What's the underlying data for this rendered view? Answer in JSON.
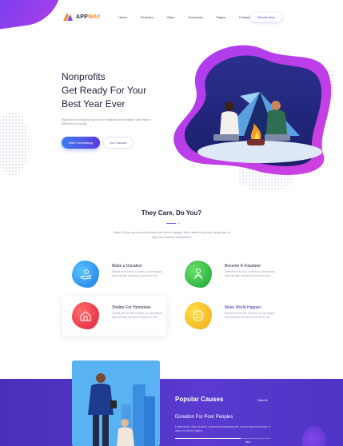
{
  "brand": {
    "name_part1": "APP",
    "name_part2": "WAY"
  },
  "nav": {
    "items": [
      "Home",
      "Features",
      "Video",
      "Download",
      "Pages",
      "Contact"
    ]
  },
  "header": {
    "donate_label": "Donate Now"
  },
  "hero": {
    "title_line1": "Nonprofits",
    "title_line2": "Get Ready For Your",
    "title_line3": "Best Year Ever",
    "description": "Make Surer to improve your donor relations and fundraise with make a difference in society.",
    "primary_button": "Start Fundraising",
    "secondary_button": "Our Causes"
  },
  "care": {
    "title": "They Care, Do You?",
    "description": "Make it Show you can with limited and fixed a change. Help children and poor people are at high risk of severe malnutrition."
  },
  "features": [
    {
      "title": "Make a Donation",
      "description": "Default text for Box Content, so use please write all data, elements & where to link."
    },
    {
      "title": "Become A Volunteer",
      "description": "Default text for Box Content, so use please write all data, elements & where to link."
    },
    {
      "title": "Shelter For Homeless",
      "description": "Default text for Box Content, so use please write all data, elements & where to link."
    },
    {
      "title": "Make World Happier",
      "description": "Default text for Box Content, so use please write all data, elements & where to link."
    }
  ],
  "causes": {
    "title": "Popular Causes",
    "view_all": "View All",
    "item_title": "Donation For Poor Peoples",
    "item_description": "Lorem ipsum dolor sit amet, consectetur adipiscing elit, sed do eiusmod tempor ut labore et dolore magna.",
    "progress_fraction": 0.68,
    "progress_label": "68%"
  },
  "colors": {
    "primary": "#5b3de0",
    "accent_orange": "#f08a2a",
    "section_bg": "#4a2fb8",
    "blob_blue": "#2e9cf2",
    "blob_green": "#2bc44a",
    "blob_red": "#ef3b4a",
    "blob_yellow": "#f5c21a"
  },
  "icons": [
    "donate-hand-icon",
    "volunteer-icon",
    "shelter-house-icon",
    "world-happy-icon"
  ]
}
